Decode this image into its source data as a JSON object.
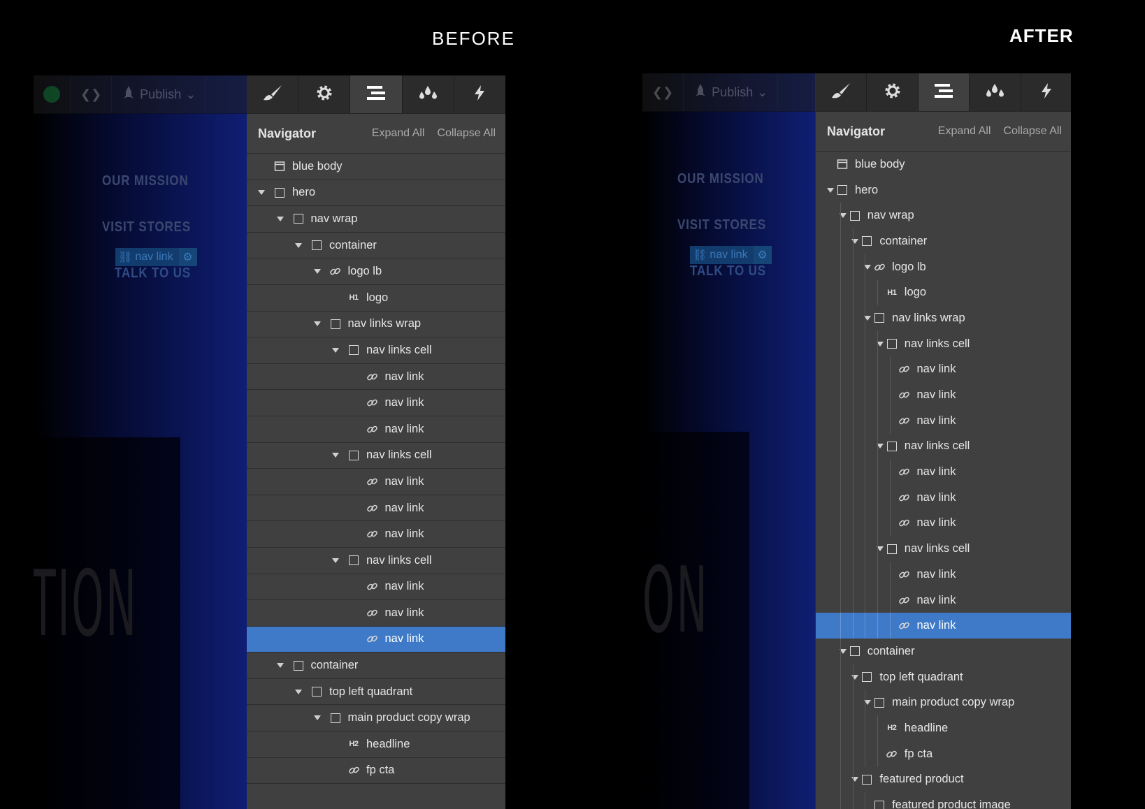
{
  "captions": {
    "before": "BEFORE",
    "after": "AFTER"
  },
  "topbar": {
    "publish_label": "Publish",
    "code_label": "❮❯"
  },
  "canvas": {
    "links": [
      "OUR MISSION",
      "VISIT STORES",
      "TALK TO US"
    ],
    "chip_label": "nav link",
    "big_text_before": "TION",
    "big_text_after": "ON"
  },
  "navigator": {
    "title": "Navigator",
    "expand_all": "Expand All",
    "collapse_all": "Collapse All"
  },
  "tabs": [
    {
      "name": "style",
      "icon": "brush-icon"
    },
    {
      "name": "settings",
      "icon": "gear-icon"
    },
    {
      "name": "navigator",
      "icon": "navigator-icon",
      "active": true
    },
    {
      "name": "color-swatches",
      "icon": "drops-icon"
    },
    {
      "name": "interactions",
      "icon": "lightning-icon"
    }
  ],
  "tree_before": [
    {
      "label": "blue body",
      "depth": 0,
      "icon": "body",
      "arrow": false
    },
    {
      "label": "hero",
      "depth": 0,
      "icon": "box",
      "arrow": true
    },
    {
      "label": "nav wrap",
      "depth": 1,
      "icon": "box",
      "arrow": true
    },
    {
      "label": "container",
      "depth": 2,
      "icon": "box",
      "arrow": true
    },
    {
      "label": "logo lb",
      "depth": 3,
      "icon": "link",
      "arrow": true
    },
    {
      "label": "logo",
      "depth": 4,
      "icon": "h1",
      "arrow": false
    },
    {
      "label": "nav links wrap",
      "depth": 3,
      "icon": "box",
      "arrow": true
    },
    {
      "label": "nav links cell",
      "depth": 4,
      "icon": "box",
      "arrow": true
    },
    {
      "label": "nav link",
      "depth": 5,
      "icon": "link",
      "arrow": false
    },
    {
      "label": "nav link",
      "depth": 5,
      "icon": "link",
      "arrow": false
    },
    {
      "label": "nav link",
      "depth": 5,
      "icon": "link",
      "arrow": false
    },
    {
      "label": "nav links cell",
      "depth": 4,
      "icon": "box",
      "arrow": true
    },
    {
      "label": "nav link",
      "depth": 5,
      "icon": "link",
      "arrow": false
    },
    {
      "label": "nav link",
      "depth": 5,
      "icon": "link",
      "arrow": false
    },
    {
      "label": "nav link",
      "depth": 5,
      "icon": "link",
      "arrow": false
    },
    {
      "label": "nav links cell",
      "depth": 4,
      "icon": "box",
      "arrow": true
    },
    {
      "label": "nav link",
      "depth": 5,
      "icon": "link",
      "arrow": false
    },
    {
      "label": "nav link",
      "depth": 5,
      "icon": "link",
      "arrow": false
    },
    {
      "label": "nav link",
      "depth": 5,
      "icon": "link",
      "arrow": false,
      "selected": true
    },
    {
      "label": "container",
      "depth": 1,
      "icon": "box",
      "arrow": true
    },
    {
      "label": "top left quadrant",
      "depth": 2,
      "icon": "box",
      "arrow": true
    },
    {
      "label": "main product copy wrap",
      "depth": 3,
      "icon": "box",
      "arrow": true
    },
    {
      "label": "headline",
      "depth": 4,
      "icon": "h2",
      "arrow": false
    },
    {
      "label": "fp cta",
      "depth": 4,
      "icon": "link",
      "arrow": false
    }
  ],
  "tree_after": [
    {
      "label": "blue body",
      "depth": 0,
      "icon": "body",
      "arrow": false
    },
    {
      "label": "hero",
      "depth": 0,
      "icon": "box",
      "arrow": true
    },
    {
      "label": "nav wrap",
      "depth": 1,
      "icon": "box",
      "arrow": true
    },
    {
      "label": "container",
      "depth": 2,
      "icon": "box",
      "arrow": true
    },
    {
      "label": "logo lb",
      "depth": 3,
      "icon": "link",
      "arrow": true
    },
    {
      "label": "logo",
      "depth": 4,
      "icon": "h1",
      "arrow": false
    },
    {
      "label": "nav links wrap",
      "depth": 3,
      "icon": "box",
      "arrow": true
    },
    {
      "label": "nav links cell",
      "depth": 4,
      "icon": "box",
      "arrow": true
    },
    {
      "label": "nav link",
      "depth": 5,
      "icon": "link",
      "arrow": false
    },
    {
      "label": "nav link",
      "depth": 5,
      "icon": "link",
      "arrow": false
    },
    {
      "label": "nav link",
      "depth": 5,
      "icon": "link",
      "arrow": false
    },
    {
      "label": "nav links cell",
      "depth": 4,
      "icon": "box",
      "arrow": true
    },
    {
      "label": "nav link",
      "depth": 5,
      "icon": "link",
      "arrow": false
    },
    {
      "label": "nav link",
      "depth": 5,
      "icon": "link",
      "arrow": false
    },
    {
      "label": "nav link",
      "depth": 5,
      "icon": "link",
      "arrow": false
    },
    {
      "label": "nav links cell",
      "depth": 4,
      "icon": "box",
      "arrow": true
    },
    {
      "label": "nav link",
      "depth": 5,
      "icon": "link",
      "arrow": false
    },
    {
      "label": "nav link",
      "depth": 5,
      "icon": "link",
      "arrow": false
    },
    {
      "label": "nav link",
      "depth": 5,
      "icon": "link",
      "arrow": false,
      "selected": true
    },
    {
      "label": "container",
      "depth": 1,
      "icon": "box",
      "arrow": true
    },
    {
      "label": "top left quadrant",
      "depth": 2,
      "icon": "box",
      "arrow": true
    },
    {
      "label": "main product copy wrap",
      "depth": 3,
      "icon": "box",
      "arrow": true
    },
    {
      "label": "headline",
      "depth": 4,
      "icon": "h2",
      "arrow": false
    },
    {
      "label": "fp cta",
      "depth": 4,
      "icon": "link",
      "arrow": false
    },
    {
      "label": "featured product",
      "depth": 2,
      "icon": "box",
      "arrow": true
    },
    {
      "label": "featured product image",
      "depth": 3,
      "icon": "box",
      "arrow": false
    }
  ],
  "colors": {
    "selected_row": "#3e7ac8",
    "panel_bg": "#404040",
    "accent_blue": "#0f1e73"
  }
}
